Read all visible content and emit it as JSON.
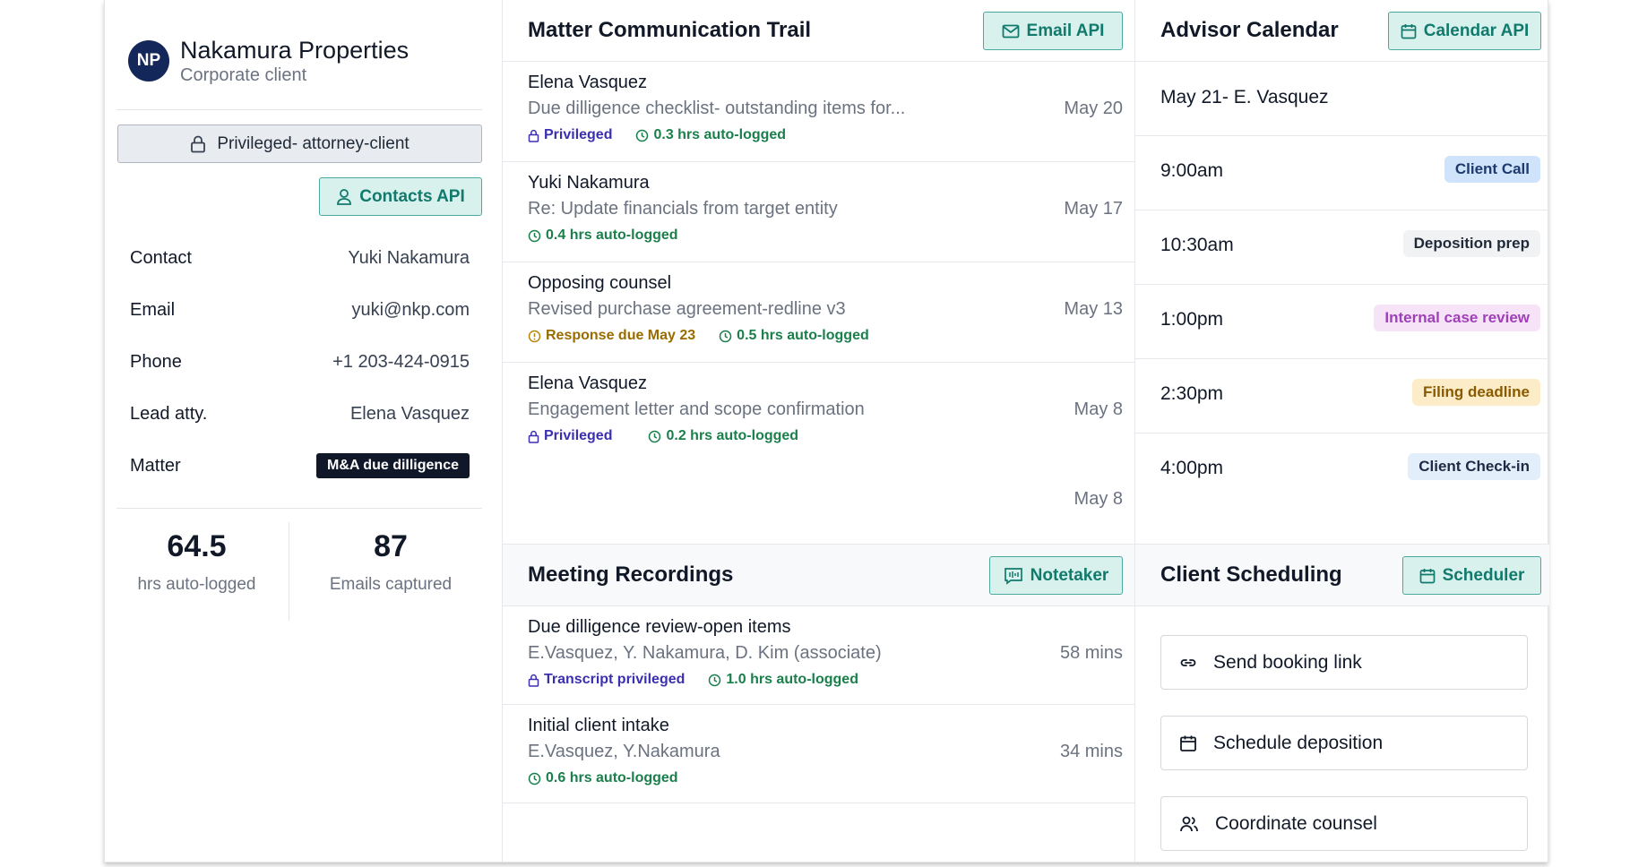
{
  "client": {
    "initials": "NP",
    "name": "Nakamura Properties",
    "type": "Corporate client",
    "privilege_label": "Privileged- attorney-client",
    "contacts_api_label": "Contacts API",
    "fields": [
      {
        "key": "Contact",
        "value": "Yuki Nakamura"
      },
      {
        "key": "Email",
        "value": "yuki@nkp.com"
      },
      {
        "key": "Phone",
        "value": "+1 203-424-0915"
      },
      {
        "key": "Lead atty.",
        "value": "Elena Vasquez"
      },
      {
        "key": "Matter",
        "value": "M&A due dilligence"
      }
    ],
    "stats": [
      {
        "value": "64.5",
        "label": "hrs auto-logged"
      },
      {
        "value": "87",
        "label": "Emails captured"
      }
    ]
  },
  "communication": {
    "title": "Matter Communication Trail",
    "api_label": "Email API",
    "items": [
      {
        "from": "Elena Vasquez",
        "subject": "Due dilligence checklist- outstanding items for...",
        "date": "May 20",
        "privileged": "Privileged",
        "logged": "0.3 hrs auto-logged"
      },
      {
        "from": "Yuki Nakamura",
        "subject": "Re: Update financials from target entity",
        "date": "May 17",
        "logged": "0.4 hrs auto-logged"
      },
      {
        "from": "Opposing counsel",
        "subject": "Revised purchase agreement-redline v3",
        "date": "May 13",
        "due": "Response due May 23",
        "logged": "0.5 hrs auto-logged"
      },
      {
        "from": "Elena Vasquez",
        "subject": "Engagement letter and scope confirmation",
        "date": "May 8",
        "privileged": "Privileged",
        "logged": "0.2 hrs auto-logged"
      }
    ],
    "trailing_date": "May 8"
  },
  "recordings": {
    "title": "Meeting Recordings",
    "api_label": "Notetaker",
    "items": [
      {
        "title": "Due dilligence review-open items",
        "participants": "E.Vasquez, Y. Nakamura, D. Kim (associate)",
        "duration": "58 mins",
        "privileged": "Transcript privileged",
        "logged": "1.0 hrs auto-logged"
      },
      {
        "title": "Initial client intake",
        "participants": "E.Vasquez, Y.Nakamura",
        "duration": "34 mins",
        "logged": "0.6 hrs auto-logged"
      }
    ]
  },
  "calendar": {
    "title": "Advisor Calendar",
    "api_label": "Calendar API",
    "date_header": "May 21- E. Vasquez",
    "events": [
      {
        "time": "9:00am",
        "label": "Client Call",
        "color": "#cfe3fb",
        "text_color": "#1e3a6e"
      },
      {
        "time": "10:30am",
        "label": "Deposition prep",
        "color": "#f1f2f4",
        "text_color": "#1f2937"
      },
      {
        "time": "1:00pm",
        "label": "Internal case review",
        "color": "#f6e3f8",
        "text_color": "#a040b8"
      },
      {
        "time": "2:30pm",
        "label": "Filing deadline",
        "color": "#fcecc7",
        "text_color": "#8a5a00"
      },
      {
        "time": "4:00pm",
        "label": "Client Check-in",
        "color": "#e3eefb",
        "text_color": "#1f2a44"
      }
    ]
  },
  "scheduling": {
    "title": "Client Scheduling",
    "api_label": "Scheduler",
    "actions": [
      {
        "label": "Send booking link",
        "icon": "link-icon"
      },
      {
        "label": "Schedule deposition",
        "icon": "calendar-icon"
      },
      {
        "label": "Coordinate counsel",
        "icon": "users-icon"
      }
    ]
  },
  "colors": {
    "accent": "#117a6d",
    "accent_bg": "#d9f1ed",
    "avatar": "#14275a",
    "privileged": "#3b2fb0",
    "logged": "#1a7f4b",
    "due": "#9a6c00"
  }
}
